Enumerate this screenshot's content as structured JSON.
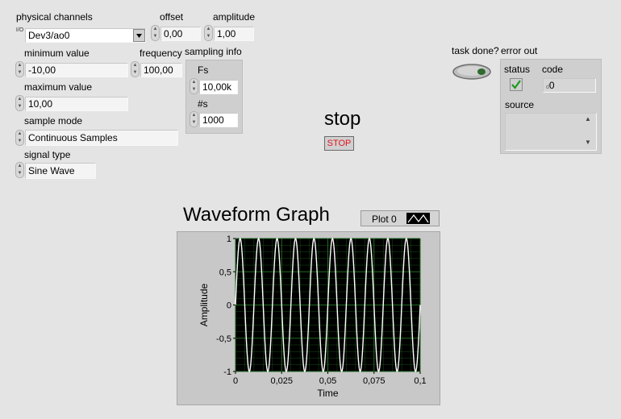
{
  "controls": {
    "physical_channels": {
      "label": "physical channels",
      "value": "Dev3/ao0",
      "io_icon": "I/O"
    },
    "offset": {
      "label": "offset",
      "value": "0,00"
    },
    "amplitude": {
      "label": "amplitude",
      "value": "1,00"
    },
    "minimum_value": {
      "label": "minimum value",
      "value": "-10,00"
    },
    "frequency": {
      "label": "frequency",
      "value": "100,00"
    },
    "maximum_value": {
      "label": "maximum value",
      "value": "10,00"
    },
    "sample_mode": {
      "label": "sample mode",
      "value": "Continuous Samples"
    },
    "signal_type": {
      "label": "signal type",
      "value": "Sine Wave"
    },
    "sampling_info": {
      "label": "sampling info",
      "fs": {
        "label": "Fs",
        "value": "10,00k"
      },
      "num_samples": {
        "label": "#s",
        "value": "1000"
      }
    }
  },
  "stop": {
    "label": "stop",
    "button_text": "STOP"
  },
  "task_done": {
    "label": "task done?"
  },
  "error_out": {
    "label": "error out",
    "status": {
      "label": "status",
      "value": true
    },
    "code": {
      "label": "code",
      "value": "0"
    },
    "source": {
      "label": "source",
      "value": ""
    }
  },
  "graph": {
    "title": "Waveform Graph",
    "legend": "Plot 0",
    "colors": {
      "plot_bg": "#000000",
      "grid": "#1f6b1f",
      "trace": "#ffffff",
      "frame": "#c8c8c8"
    }
  },
  "chart_data": {
    "type": "line",
    "title": "Waveform Graph",
    "xlabel": "Time",
    "ylabel": "Amplitude",
    "xlim": [
      0,
      0.1
    ],
    "ylim": [
      -1,
      1
    ],
    "x_ticks": [
      "0",
      "0,025",
      "0,05",
      "0,075",
      "0,1"
    ],
    "y_ticks": [
      "1",
      "0,5",
      "0",
      "-0,5",
      "-1"
    ],
    "grid": true,
    "series": [
      {
        "name": "Plot 0",
        "function": "sine",
        "frequency_hz": 100,
        "amplitude": 1,
        "offset": 0,
        "sample_rate_hz": 10000,
        "samples": 1000
      }
    ]
  }
}
